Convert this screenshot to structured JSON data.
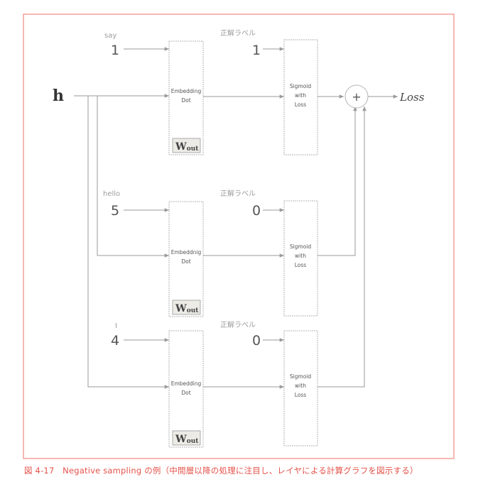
{
  "input": {
    "symbol": "h"
  },
  "rows": [
    {
      "word": "say",
      "index": "1",
      "label_header": "正解ラベル",
      "label": "1",
      "embed_line1": "Embedding",
      "embed_line2": "Dot",
      "weight_main": "W",
      "weight_sub": "out",
      "loss_line1": "Sigmoid",
      "loss_line2": "with",
      "loss_line3": "Loss"
    },
    {
      "word": "hello",
      "index": "5",
      "label_header": "正解ラベル",
      "label": "0",
      "embed_line1": "Embeddnig",
      "embed_line2": "Dot",
      "weight_main": "W",
      "weight_sub": "out",
      "loss_line1": "Sigmoid",
      "loss_line2": "with",
      "loss_line3": "Loss"
    },
    {
      "word": "I",
      "index": "4",
      "label_header": "正解ラベル",
      "label": "0",
      "embed_line1": "Embedding",
      "embed_line2": "Dot",
      "weight_main": "W",
      "weight_sub": "out",
      "loss_line1": "Sigmoid",
      "loss_line2": "with",
      "loss_line3": "Loss"
    }
  ],
  "sum_node": {
    "symbol": "+"
  },
  "output": {
    "label": "Loss"
  },
  "caption": "図 4-17　Negative sampling の例（中間層以降の処理に注目し、レイヤによる計算グラフを図示する）",
  "colors": {
    "frame": "#f08a7e",
    "line": "#9a9a9a",
    "box": "#b5b5b5",
    "text_dark": "#555555",
    "text_light": "#9c9c9c",
    "weight_bg": "#ecebe6",
    "caption": "#e4524a"
  }
}
